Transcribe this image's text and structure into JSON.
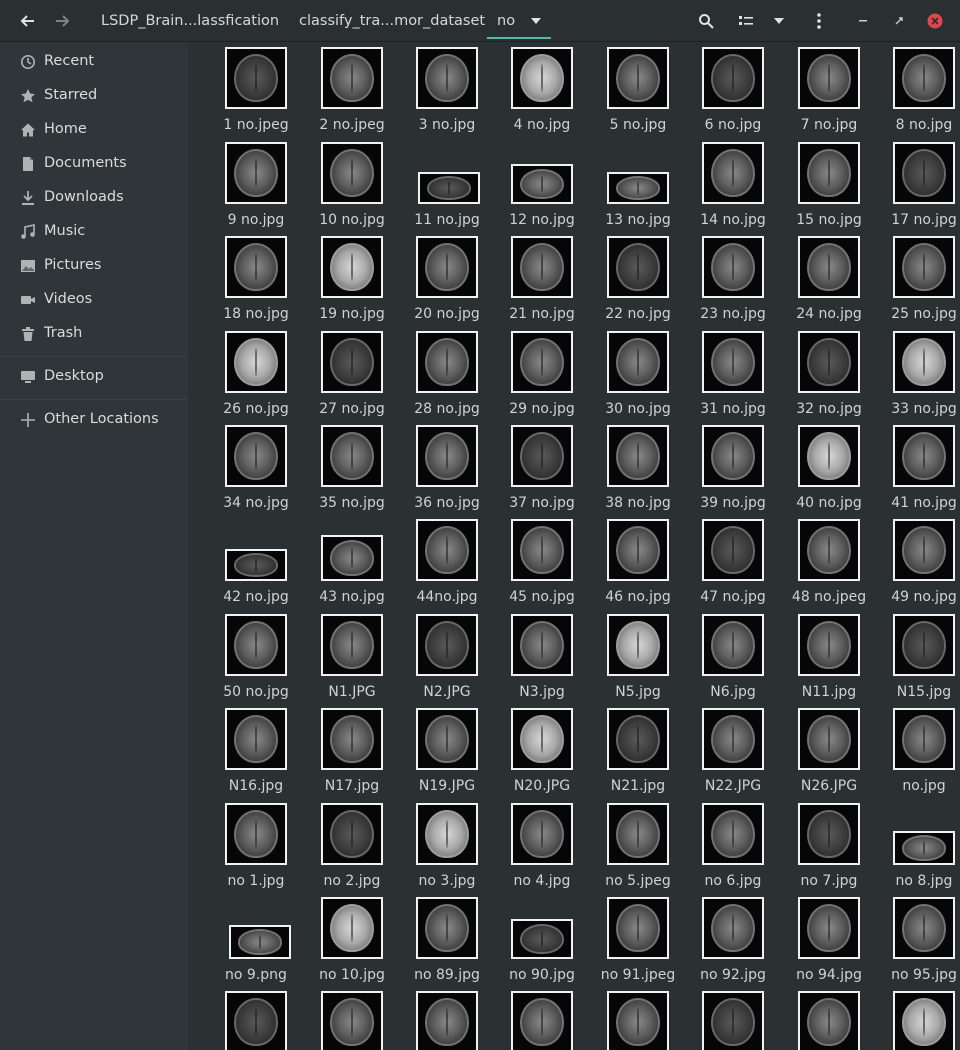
{
  "window": {
    "breadcrumbs": [
      "LSDP_Brain...lassfication",
      "classify_tra...mor_dataset",
      "no"
    ]
  },
  "sidebar": {
    "items": [
      {
        "label": "Recent",
        "icon": "clock-icon"
      },
      {
        "label": "Starred",
        "icon": "star-icon"
      },
      {
        "label": "Home",
        "icon": "home-icon"
      },
      {
        "label": "Documents",
        "icon": "document-icon"
      },
      {
        "label": "Downloads",
        "icon": "download-icon"
      },
      {
        "label": "Music",
        "icon": "music-icon"
      },
      {
        "label": "Pictures",
        "icon": "picture-icon"
      },
      {
        "label": "Videos",
        "icon": "video-icon"
      },
      {
        "label": "Trash",
        "icon": "trash-icon"
      },
      {
        "label": "Desktop",
        "icon": "desktop-icon"
      },
      {
        "label": "Other Locations",
        "icon": "plus-icon"
      }
    ]
  },
  "files": [
    "1 no.jpeg",
    "2 no.jpeg",
    "3 no.jpg",
    "4 no.jpg",
    "5 no.jpg",
    "6 no.jpg",
    "7 no.jpg",
    "8 no.jpg",
    "9 no.jpg",
    "10 no.jpg",
    "11 no.jpg",
    "12 no.jpg",
    "13 no.jpg",
    "14 no.jpg",
    "15 no.jpg",
    "17 no.jpg",
    "18 no.jpg",
    "19 no.jpg",
    "20 no.jpg",
    "21 no.jpg",
    "22 no.jpg",
    "23 no.jpg",
    "24 no.jpg",
    "25 no.jpg",
    "26 no.jpg",
    "27 no.jpg",
    "28 no.jpg",
    "29 no.jpg",
    "30 no.jpg",
    "31 no.jpg",
    "32 no.jpg",
    "33 no.jpg",
    "34 no.jpg",
    "35 no.jpg",
    "36 no.jpg",
    "37 no.jpg",
    "38 no.jpg",
    "39 no.jpg",
    "40 no.jpg",
    "41 no.jpg",
    "42 no.jpg",
    "43 no.jpg",
    "44no.jpg",
    "45 no.jpg",
    "46 no.jpg",
    "47 no.jpg",
    "48 no.jpeg",
    "49 no.jpg",
    "50 no.jpg",
    "N1.JPG",
    "N2.JPG",
    "N3.jpg",
    "N5.jpg",
    "N6.jpg",
    "N11.jpg",
    "N15.jpg",
    "N16.jpg",
    "N17.jpg",
    "N19.JPG",
    "N20.JPG",
    "N21.jpg",
    "N22.JPG",
    "N26.JPG",
    "no.jpg",
    "no 1.jpg",
    "no 2.jpg",
    "no 3.jpg",
    "no 4.jpg",
    "no 5.jpeg",
    "no 6.jpg",
    "no 7.jpg",
    "no 8.jpg",
    "no 9.png",
    "no 10.jpg",
    "no 89.jpg",
    "no 90.jpg",
    "no 91.jpeg",
    "no 92.jpg",
    "no 94.jpg",
    "no 95.jpg",
    "",
    "",
    "",
    "",
    "",
    "",
    "",
    ""
  ],
  "colors": {
    "accent": "#5ab5a9",
    "close_button": "#e0474a"
  }
}
